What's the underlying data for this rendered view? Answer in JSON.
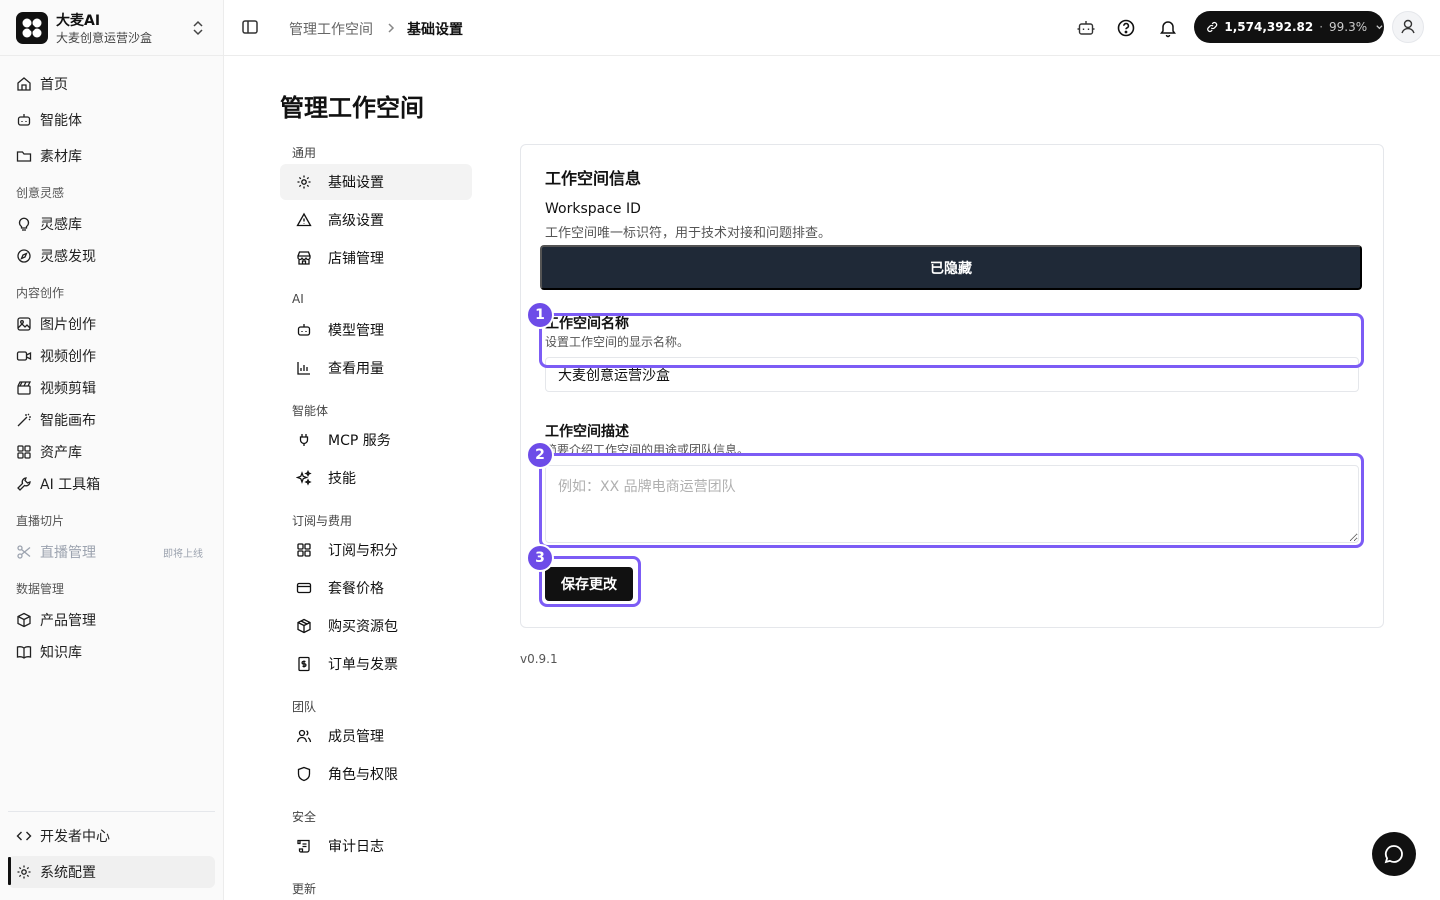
{
  "brand": {
    "name": "大麦AI",
    "workspace": "大麦创意运营沙盒"
  },
  "sidebar": {
    "items": [
      {
        "label": "首页",
        "icon": "home-icon"
      },
      {
        "label": "智能体",
        "icon": "robot-icon"
      },
      {
        "label": "素材库",
        "icon": "folder-icon"
      }
    ],
    "groups": [
      {
        "title": "创意灵感",
        "items": [
          {
            "label": "灵感库",
            "icon": "lightbulb-icon"
          },
          {
            "label": "灵感发现",
            "icon": "compass-icon"
          }
        ]
      },
      {
        "title": "内容创作",
        "items": [
          {
            "label": "图片创作",
            "icon": "image-icon"
          },
          {
            "label": "视频创作",
            "icon": "video-icon"
          },
          {
            "label": "视频剪辑",
            "icon": "clapperboard-icon"
          },
          {
            "label": "智能画布",
            "icon": "magic-wand-icon"
          },
          {
            "label": "资产库",
            "icon": "grid-icon"
          },
          {
            "label": "AI 工具箱",
            "icon": "wrench-icon"
          }
        ]
      },
      {
        "title": "直播切片",
        "items": [
          {
            "label": "直播管理",
            "icon": "scissors-icon",
            "badge": "即将上线",
            "disabled": true
          }
        ]
      },
      {
        "title": "数据管理",
        "items": [
          {
            "label": "产品管理",
            "icon": "box-icon"
          },
          {
            "label": "知识库",
            "icon": "book-icon"
          }
        ]
      }
    ],
    "footer": [
      {
        "label": "开发者中心",
        "icon": "code-icon"
      },
      {
        "label": "系统配置",
        "icon": "gear-icon",
        "active": true
      }
    ]
  },
  "topbar": {
    "breadcrumb": [
      "管理工作空间",
      "基础设置"
    ],
    "credits": {
      "amount": "1,574,392.82",
      "percent": "99.3%"
    }
  },
  "page": {
    "title": "管理工作空间"
  },
  "settings_nav": [
    {
      "group": "通用",
      "items": [
        {
          "label": "基础设置",
          "icon": "gear-icon",
          "active": true
        },
        {
          "label": "高级设置",
          "icon": "warning-icon"
        },
        {
          "label": "店铺管理",
          "icon": "store-icon"
        }
      ]
    },
    {
      "group": "AI",
      "items": [
        {
          "label": "模型管理",
          "icon": "robot-icon"
        },
        {
          "label": "查看用量",
          "icon": "bar-chart-icon"
        }
      ]
    },
    {
      "group": "智能体",
      "items": [
        {
          "label": "MCP 服务",
          "icon": "plug-icon"
        },
        {
          "label": "技能",
          "icon": "sparkles-icon"
        }
      ]
    },
    {
      "group": "订阅与费用",
      "items": [
        {
          "label": "订阅与积分",
          "icon": "grid-icon"
        },
        {
          "label": "套餐价格",
          "icon": "credit-card-icon"
        },
        {
          "label": "购买资源包",
          "icon": "package-icon"
        },
        {
          "label": "订单与发票",
          "icon": "receipt-icon"
        }
      ]
    },
    {
      "group": "团队",
      "items": [
        {
          "label": "成员管理",
          "icon": "users-icon"
        },
        {
          "label": "角色与权限",
          "icon": "shield-icon"
        }
      ]
    },
    {
      "group": "安全",
      "items": [
        {
          "label": "审计日志",
          "icon": "scroll-icon"
        }
      ]
    },
    {
      "group": "更新",
      "items": []
    }
  ],
  "card": {
    "title": "工作空间信息",
    "workspace_id": {
      "label": "Workspace ID",
      "hint": "工作空间唯一标识符，用于技术对接和问题排查。",
      "button": "已隐藏"
    },
    "name": {
      "label": "工作空间名称",
      "hint": "设置工作空间的显示名称。",
      "value": "大麦创意运营沙盒"
    },
    "description": {
      "label": "工作空间描述",
      "hint": "简要介绍工作空间的用途或团队信息。",
      "placeholder": "例如：XX 品牌电商运营团队"
    },
    "save": "保存更改"
  },
  "markers": [
    "1",
    "2",
    "3"
  ],
  "version": "v0.9.1",
  "colors": {
    "accent": "#7c5cf5",
    "marker": "#6d4ce8",
    "dark": "#1f2937"
  }
}
